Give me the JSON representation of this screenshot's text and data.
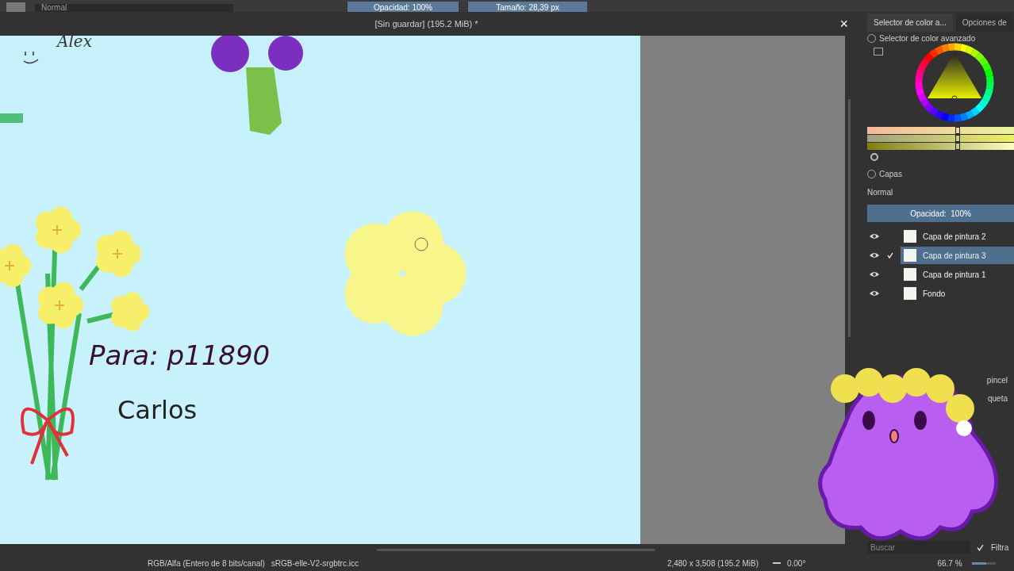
{
  "toolbar": {
    "blend_mode": "Normal",
    "opacity": {
      "label": "Opacidad: 100%",
      "level": 1
    },
    "size": {
      "label": "Tamaño: 28,39 px",
      "level": 1
    }
  },
  "document_tab": {
    "title": "[Sin guardar]  (195.2 MiB) *",
    "close": "×"
  },
  "canvas": {
    "texts": [
      "Alex",
      "Para: p11890",
      "Carlos"
    ]
  },
  "dock_tabs": [
    {
      "label": "Selector de color a...",
      "selected": true
    },
    {
      "label": "Opciones de",
      "selected": false
    }
  ],
  "color_selector": {
    "title": "Selector de color avanzado",
    "sliders": [
      {
        "level": 0.6
      },
      {
        "level": 0.6
      },
      {
        "level": 0.6
      }
    ]
  },
  "layers": {
    "title": "Capas",
    "blend_mode": "Normal",
    "opacity": {
      "label": "Opacidad:  100%",
      "level": 1
    },
    "items": [
      {
        "name": "Capa de pintura 2",
        "visible": true,
        "selected": false,
        "checked": false
      },
      {
        "name": "Capa de pintura 3",
        "visible": true,
        "selected": true,
        "checked": true
      },
      {
        "name": "Capa de pintura 1",
        "visible": true,
        "selected": false,
        "checked": false
      },
      {
        "name": "Fondo",
        "visible": true,
        "selected": false,
        "checked": false
      }
    ]
  },
  "brushes": {
    "labels": [
      "pincel",
      "queta"
    ],
    "search": {
      "placeholder": "Buscar"
    },
    "filter": {
      "label": "Filtra",
      "checked": true
    }
  },
  "status_bar": {
    "color_space": "RGB/Alfa (Entero de 8 bits/canal)",
    "profile": "sRGB-elle-V2-srgbtrc.icc",
    "dimensions": "2,480 x 3,508 (195.2 MiB)",
    "rotation": "0.00°",
    "zoom": "66.7 %",
    "zoom_slider": {
      "level": 0.6
    }
  }
}
